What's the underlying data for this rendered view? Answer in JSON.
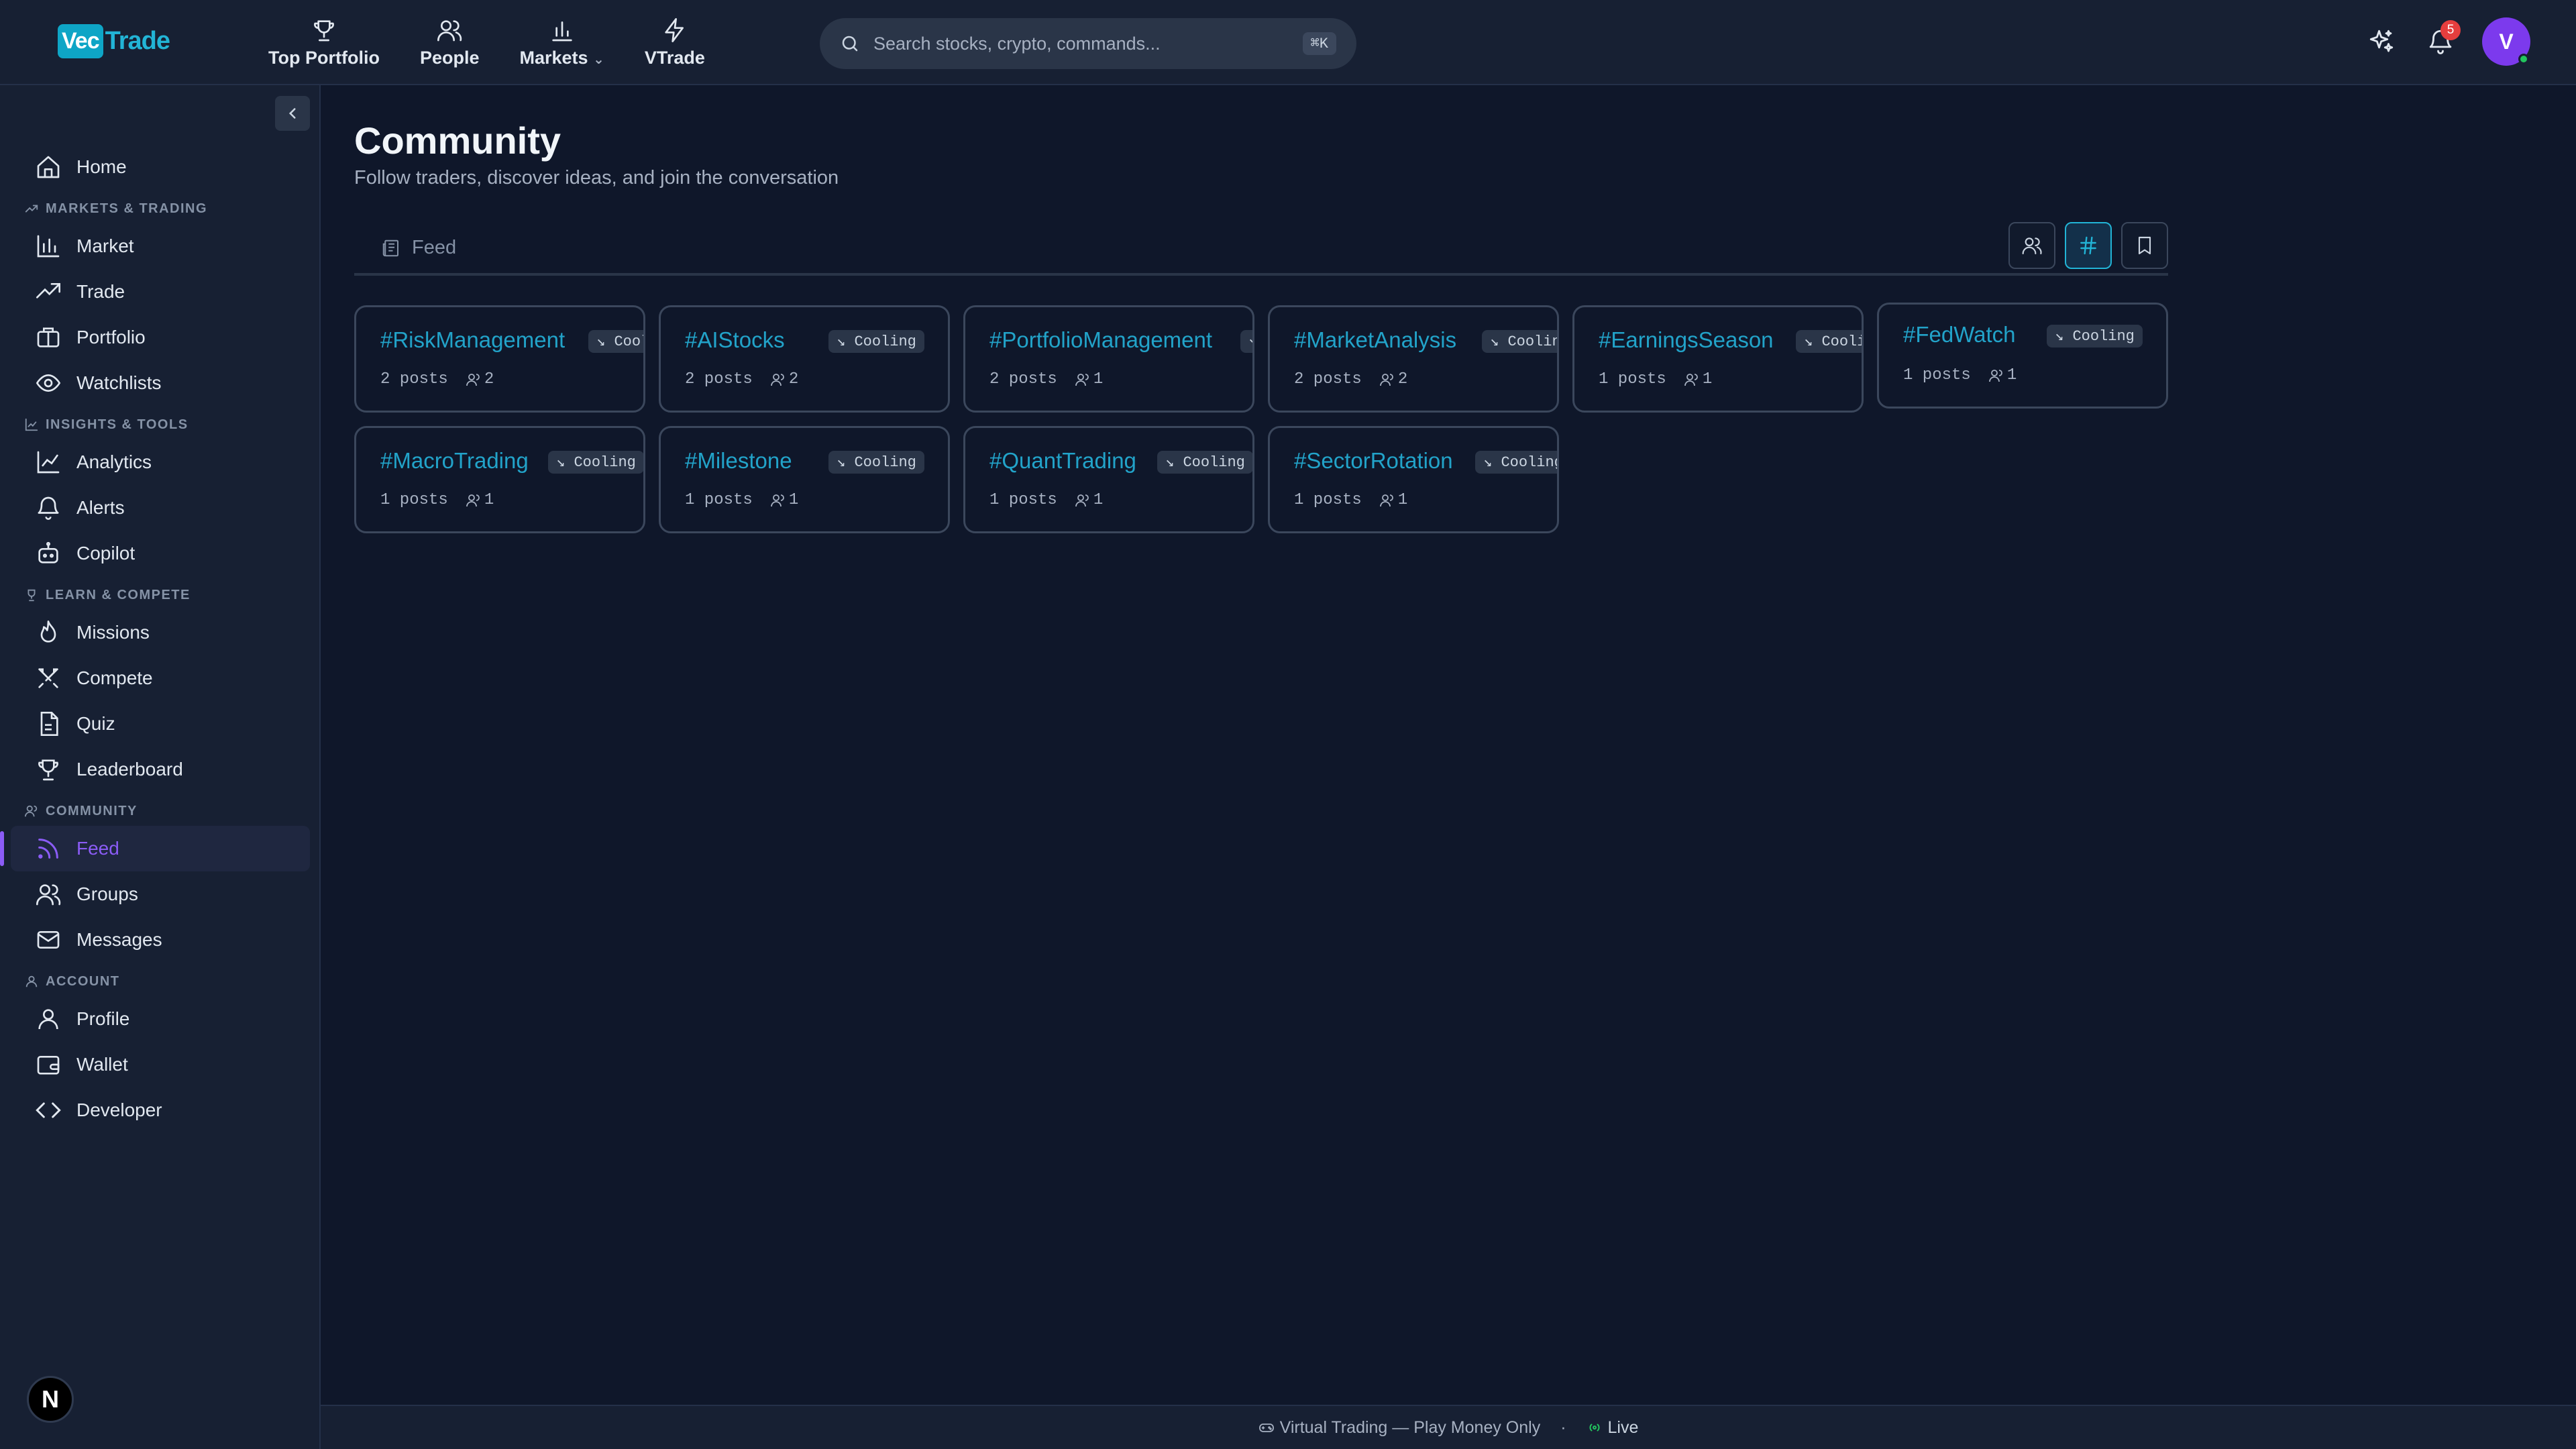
{
  "app": {
    "logo_box": "Vec",
    "logo_text": "Trade"
  },
  "topnav": [
    {
      "label": "Top Portfolio",
      "icon": "trophy-icon"
    },
    {
      "label": "People",
      "icon": "users-icon"
    },
    {
      "label": "Markets",
      "icon": "bar-chart-icon"
    },
    {
      "label": "VTrade",
      "icon": "lightning-icon"
    }
  ],
  "search": {
    "placeholder": "Search stocks, crypto, commands...",
    "shortcut": "⌘K"
  },
  "notifications": {
    "count": "5"
  },
  "user": {
    "initial": "V"
  },
  "sidebar": {
    "home": "Home",
    "sections": {
      "markets": "MARKETS & TRADING",
      "insights": "INSIGHTS & TOOLS",
      "learn": "LEARN & COMPETE",
      "community": "COMMUNITY",
      "account": "ACCOUNT"
    },
    "items": {
      "market": "Market",
      "trade": "Trade",
      "portfolio": "Portfolio",
      "watchlists": "Watchlists",
      "analytics": "Analytics",
      "alerts": "Alerts",
      "copilot": "Copilot",
      "missions": "Missions",
      "compete": "Compete",
      "quiz": "Quiz",
      "leaderboard": "Leaderboard",
      "feed": "Feed",
      "groups": "Groups",
      "messages": "Messages",
      "profile": "Profile",
      "wallet": "Wallet",
      "developer": "Developer"
    },
    "n_button": "N"
  },
  "page": {
    "title": "Community",
    "subtitle": "Follow traders, discover ideas, and join the conversation",
    "tab_feed": "Feed"
  },
  "topics": [
    {
      "tag": "#RiskManagement",
      "badge": "↘ Cooling",
      "posts": "2 posts",
      "users": "2"
    },
    {
      "tag": "#AIStocks",
      "badge": "↘ Cooling",
      "posts": "2 posts",
      "users": "2"
    },
    {
      "tag": "#PortfolioManagement",
      "badge": "↘ Cooling",
      "posts": "2 posts",
      "users": "1"
    },
    {
      "tag": "#MarketAnalysis",
      "badge": "↘ Cooling",
      "posts": "2 posts",
      "users": "2"
    },
    {
      "tag": "#EarningsSeason",
      "badge": "↘ Cooling",
      "posts": "1 posts",
      "users": "1"
    },
    {
      "tag": "#FedWatch",
      "badge": "↘ Cooling",
      "posts": "1 posts",
      "users": "1"
    },
    {
      "tag": "#MacroTrading",
      "badge": "↘ Cooling",
      "posts": "1 posts",
      "users": "1"
    },
    {
      "tag": "#Milestone",
      "badge": "↘ Cooling",
      "posts": "1 posts",
      "users": "1"
    },
    {
      "tag": "#QuantTrading",
      "badge": "↘ Cooling",
      "posts": "1 posts",
      "users": "1"
    },
    {
      "tag": "#SectorRotation",
      "badge": "↘ Cooling",
      "posts": "1 posts",
      "users": "1"
    }
  ],
  "footer": {
    "left": "Virtual Trading — Play Money Only",
    "sep": "·",
    "live": "Live"
  }
}
